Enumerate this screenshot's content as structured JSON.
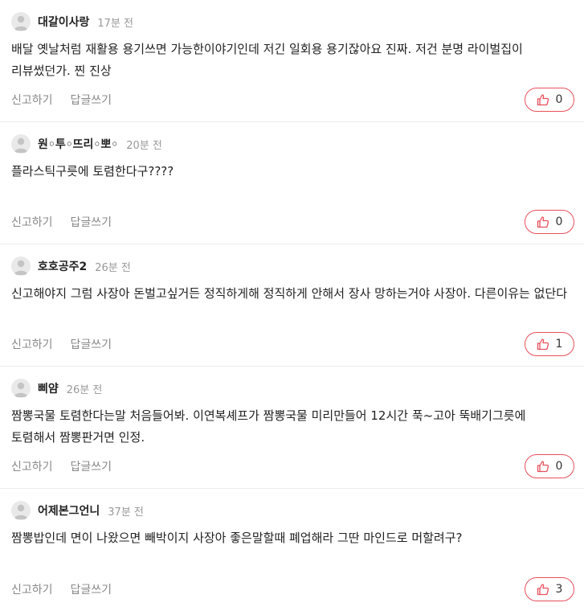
{
  "labels": {
    "report": "신고하기",
    "reply": "답글쓰기"
  },
  "colors": {
    "accent": "#e8505b",
    "muted": "#888888",
    "time": "#999999"
  },
  "icons": {
    "avatar": "user-avatar-icon",
    "like": "thumbs-up-icon"
  },
  "comments": [
    {
      "nickname": "대갈이사랑",
      "time": "17분 전",
      "text": "배달 옛날처럼 재활용 용기쓰면 가능한이야기인데 저긴 일회용 용기잖아요 진짜. 저건 분명 라이벌집이 리뷰썼던가. 찐 진상",
      "likes": "0"
    },
    {
      "nickname": "원◦투◦뜨리◦뽀◦",
      "time": "20분 전",
      "text": "플라스틱구릇에 토렴한다구????",
      "likes": "0"
    },
    {
      "nickname": "호호공주2",
      "time": "26분 전",
      "text": "신고해야지 그럼 사장아 돈벌고싶거든 정직하게해 정직하게 안해서 장사 망하는거야 사장아. 다른이유는 없단다",
      "likes": "1"
    },
    {
      "nickname": "삐얌",
      "time": "26분 전",
      "text": "짬뽕국물 토렴한다는말 처음들어봐. 이연복셰프가 짬뽕국물 미리만들어 12시간 푹~고아 뚝배기그릇에 토렴해서 짬뽕판거면 인정.",
      "likes": "0"
    },
    {
      "nickname": "어제본그언니",
      "time": "37분 전",
      "text": "짬뽕밥인데 면이 나왔으면 빼박이지 사장아 좋은말할때 폐업해라 그딴 마인드로 머할려구?",
      "likes": "3"
    }
  ]
}
